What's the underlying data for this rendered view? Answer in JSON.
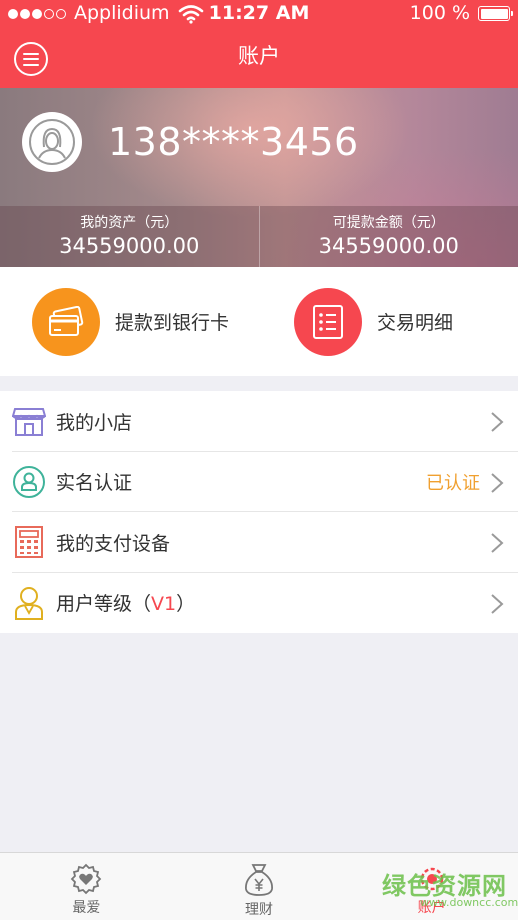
{
  "status_bar": {
    "carrier": "Applidium",
    "time": "11:27 AM",
    "battery": "100 %",
    "signal_bars_filled": 3,
    "signal_bars_total": 5
  },
  "nav": {
    "title": "账户",
    "menu_icon": "menu-icon"
  },
  "profile": {
    "phone": "138****3456",
    "assets_label": "我的资产（元）",
    "assets_value": "34559000.00",
    "withdrawable_label": "可提款金额（元）",
    "withdrawable_value": "34559000.00"
  },
  "actions": [
    {
      "label": "提款到银行卡",
      "icon": "bank-card-icon",
      "color": "#f7941d"
    },
    {
      "label": "交易明细",
      "icon": "transaction-list-icon",
      "color": "#f6474f"
    }
  ],
  "list": [
    {
      "label": "我的小店",
      "icon": "shop-icon",
      "icon_color": "#8a7fd4"
    },
    {
      "label": "实名认证",
      "icon": "id-verify-icon",
      "icon_color": "#3fb39a",
      "extra": "已认证"
    },
    {
      "label": "我的支付设备",
      "icon": "pos-device-icon",
      "icon_color": "#e86a5a"
    },
    {
      "label_prefix": "用户等级（",
      "level": "V1",
      "label_suffix": "）",
      "icon": "user-level-icon",
      "icon_color": "#e0b020"
    }
  ],
  "tabs": [
    {
      "label": "最爱",
      "icon": "heart-badge-icon"
    },
    {
      "label": "理财",
      "icon": "money-bag-icon"
    },
    {
      "label": "账户",
      "icon": "gear-account-icon",
      "active": true
    }
  ],
  "watermark": {
    "text": "绿色资源网",
    "sub": "www.downcc.com"
  },
  "colors": {
    "primary": "#f6474f",
    "orange": "#f7941d",
    "verified": "#f0a030"
  }
}
